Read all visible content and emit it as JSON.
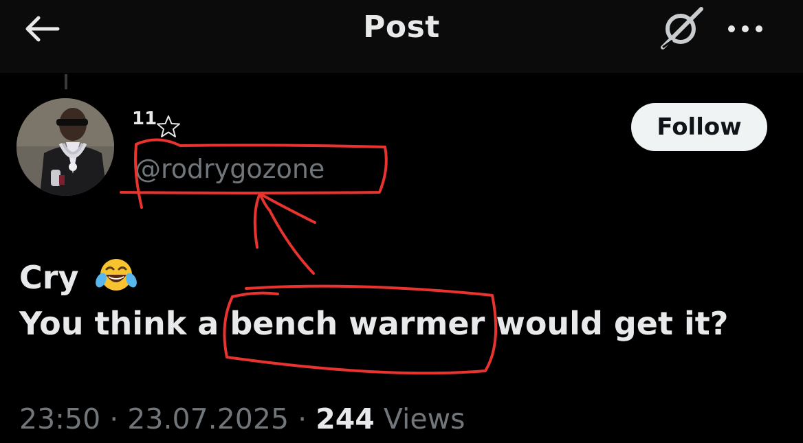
{
  "header": {
    "title": "Post",
    "back_icon": "arrow-left-icon",
    "grok_icon": "grok-icon",
    "more_icon": "more-dots-icon"
  },
  "author": {
    "display_name": "11",
    "badge_icon": "star-outline-icon",
    "handle": "@rodrygozone",
    "follow_label": "Follow"
  },
  "tweet": {
    "line1": "Cry",
    "line1_emoji": "face-with-tears-of-joy-emoji",
    "line2": "You think a bench warmer would get it?"
  },
  "meta": {
    "time": "23:50",
    "separator": "·",
    "date": "23.07.2025",
    "views_count": "244",
    "views_label": "Views"
  },
  "colors": {
    "background": "#000000",
    "header_bg": "#0b0b0b",
    "primary_text": "#e7e9ea",
    "secondary_text": "#71767b",
    "follow_bg": "#eff3f4",
    "annotation_red": "#e8332f"
  }
}
